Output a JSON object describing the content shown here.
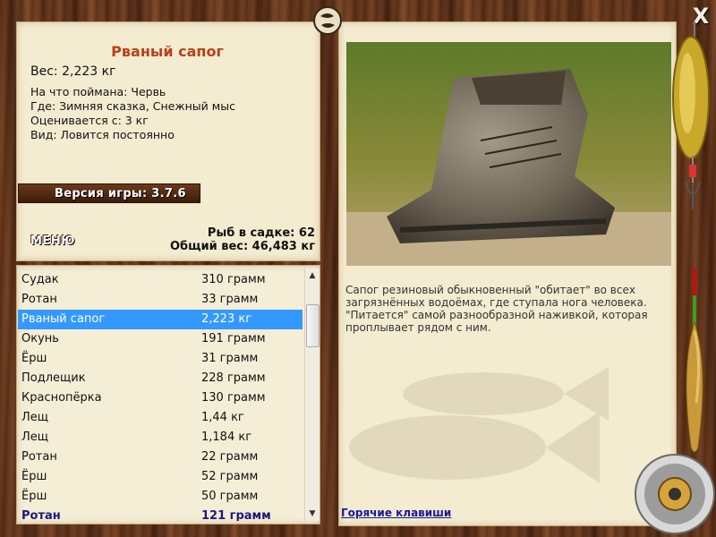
{
  "fish": {
    "name": "Рваный сапог",
    "weight": "Вес: 2,223 кг",
    "caught_with": "На что поймана: Червь",
    "location": "Где: Зимняя сказка, Снежный мыс",
    "valued_from": "Оценивается с: 3 кг",
    "type": "Вид: Ловится постоянно",
    "description": "Сапог резиновый обыкновенный \"обитает\" во всех загрязнённых водоёмах, где ступала нога человека. \"Питается\" самой разнообразной наживкой, которая проплывает рядом с ним."
  },
  "version_label": "Версия игры: 3.7.6",
  "menu_label": "МЕНЮ",
  "stats": {
    "fish_in_keepnet": "Рыб в садке: 62",
    "total_weight": "Общий вес: 46,483 кг"
  },
  "hotkeys_label": "Горячие клавиши",
  "close_label": "X",
  "list": [
    {
      "name": "Судак",
      "weight": "310 грамм"
    },
    {
      "name": "Ротан",
      "weight": "33 грамм"
    },
    {
      "name": "Рваный сапог",
      "weight": "2,223 кг"
    },
    {
      "name": "Окунь",
      "weight": "191 грамм"
    },
    {
      "name": "Ёрш",
      "weight": "31 грамм"
    },
    {
      "name": "Подлещик",
      "weight": "228 грамм"
    },
    {
      "name": "Краснопёрка",
      "weight": "130 грамм"
    },
    {
      "name": "Лещ",
      "weight": "1,44 кг"
    },
    {
      "name": "Лещ",
      "weight": "1,184 кг"
    },
    {
      "name": "Ротан",
      "weight": "22 грамм"
    },
    {
      "name": "Ёрш",
      "weight": "52 грамм"
    },
    {
      "name": "Ёрш",
      "weight": "50 грамм"
    },
    {
      "name": "Ротан",
      "weight": "121 грамм"
    }
  ],
  "selected_index": 2,
  "icons": {
    "close": "close-icon",
    "emblem": "pisces-emblem-icon",
    "scroll_up": "scroll-up-arrow-icon",
    "scroll_down": "scroll-down-arrow-icon"
  },
  "colors": {
    "title": "#b8401a",
    "selection": "#3399ff",
    "link": "#1a1a9c",
    "panel": "#f3ecd0"
  }
}
